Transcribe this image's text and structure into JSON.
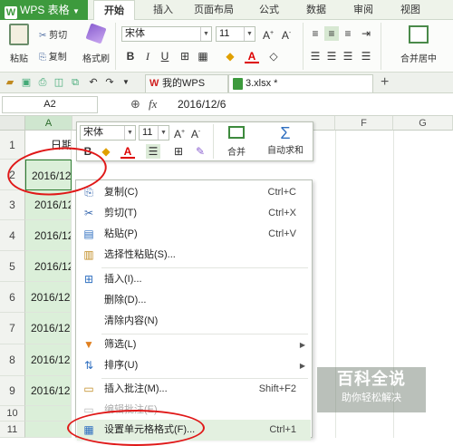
{
  "app": {
    "name": "WPS 表格",
    "logo_letter": "W"
  },
  "menu_tabs": [
    "开始",
    "插入",
    "页面布局",
    "公式",
    "数据",
    "审阅",
    "视图"
  ],
  "ribbon": {
    "paste": "粘贴",
    "cut": "剪切",
    "copy": "复制",
    "format_painter": "格式刷",
    "font": "宋体",
    "size": "11",
    "bold": "B",
    "italic": "I",
    "underline": "U",
    "merge": "合并居中"
  },
  "doc_tabs": [
    {
      "label": "我的WPS"
    },
    {
      "label": "3.xlsx *"
    }
  ],
  "formula_bar": {
    "cell_ref": "A2",
    "fx": "fx",
    "value": "2016/12/6"
  },
  "columns": [
    "A",
    "F",
    "G"
  ],
  "rows": [
    "1",
    "2",
    "3",
    "4",
    "5",
    "6",
    "7",
    "8",
    "9",
    "10",
    "11"
  ],
  "cells": [
    "日期",
    "2016/12/6",
    "2016/12",
    "2016/12",
    "2016/12",
    "2016/12",
    "2016/12",
    "2016/12",
    "2016/12"
  ],
  "mini_toolbar": {
    "font": "宋体",
    "size": "11",
    "bold": "B",
    "merge": "合并",
    "autosum": "自动求和"
  },
  "context_menu": {
    "items": [
      {
        "label": "复制(C)",
        "shortcut": "Ctrl+C",
        "icon": "copy-icon"
      },
      {
        "label": "剪切(T)",
        "shortcut": "Ctrl+X",
        "icon": "scissors-icon"
      },
      {
        "label": "粘贴(P)",
        "shortcut": "Ctrl+V",
        "icon": "paste-icon"
      },
      {
        "label": "选择性粘贴(S)...",
        "shortcut": "",
        "icon": "paste-special-icon"
      },
      {
        "label": "插入(I)...",
        "shortcut": "",
        "icon": "insert-icon"
      },
      {
        "label": "删除(D)...",
        "shortcut": "",
        "icon": ""
      },
      {
        "label": "清除内容(N)",
        "shortcut": "",
        "icon": ""
      },
      {
        "label": "筛选(L)",
        "shortcut": "",
        "icon": "filter-icon"
      },
      {
        "label": "排序(U)",
        "shortcut": "",
        "icon": "sort-icon"
      },
      {
        "label": "插入批注(M)...",
        "shortcut": "Shift+F2",
        "icon": "comment-icon"
      },
      {
        "label": "编辑批注(E)",
        "shortcut": "",
        "icon": "edit-comment-icon"
      },
      {
        "label": "设置单元格格式(F)...",
        "shortcut": "Ctrl+1",
        "icon": "format-cells-icon"
      }
    ]
  },
  "watermark": {
    "title": "百科全说",
    "subtitle": "助你轻松解决"
  },
  "colors": {
    "brand": "#3d9a3d",
    "annotation": "#e01818",
    "selection": "#dbefd9"
  }
}
